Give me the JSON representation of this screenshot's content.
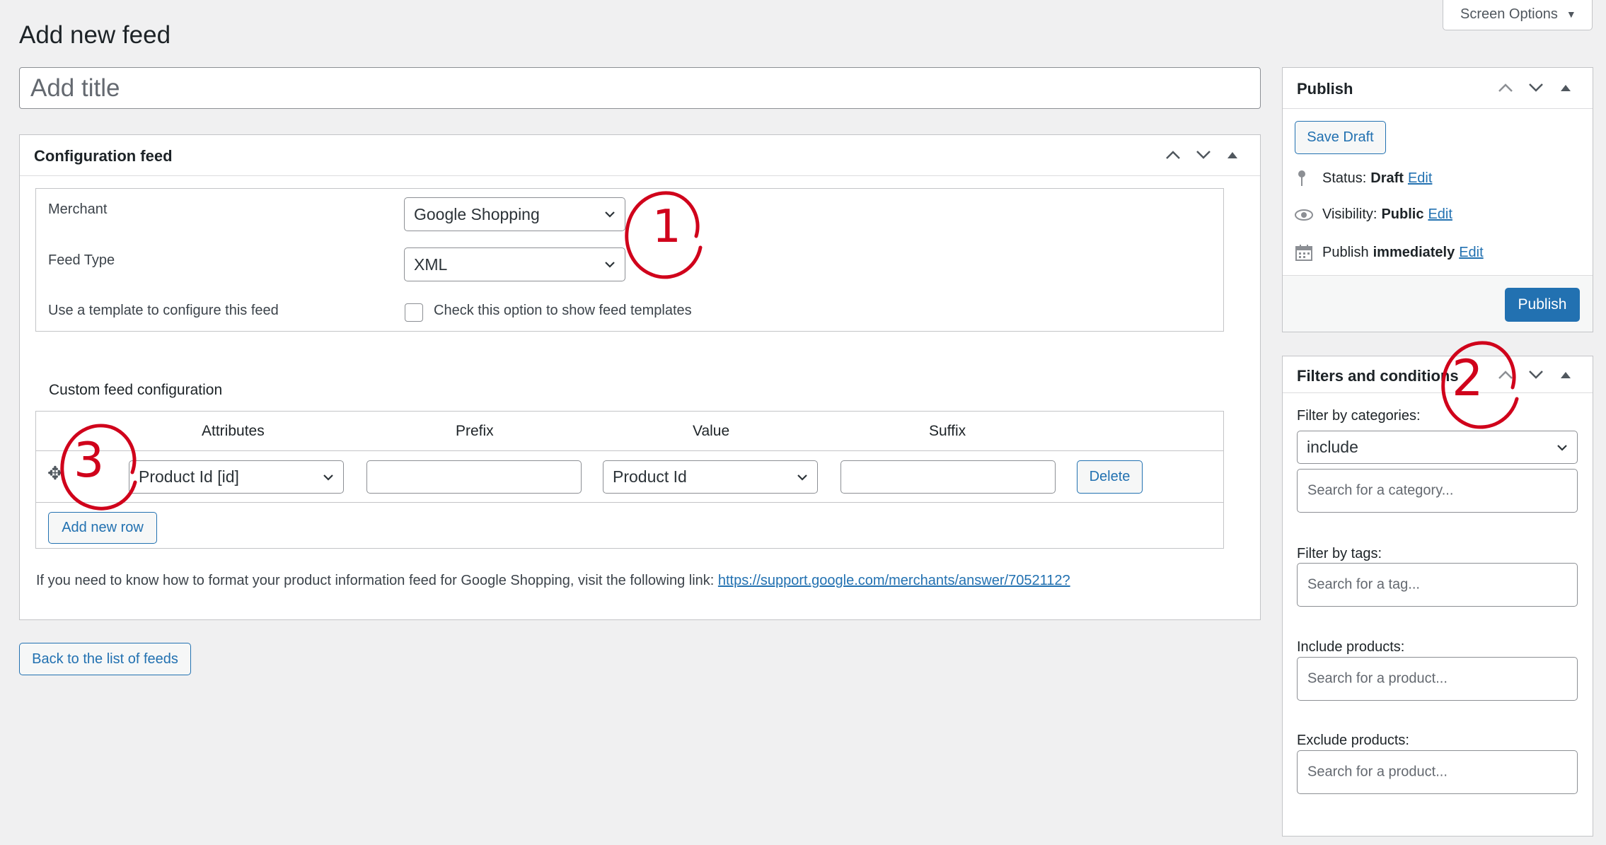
{
  "page": {
    "title": "Add new feed",
    "screen_options_label": "Screen Options",
    "title_placeholder": "Add title",
    "back_button": "Back to the list of feeds"
  },
  "config": {
    "header": "Configuration feed",
    "merchant_label": "Merchant",
    "merchant_value": "Google Shopping",
    "feed_type_label": "Feed Type",
    "feed_type_value": "XML",
    "template_label": "Use a template to configure this feed",
    "template_checkbox_label": "Check this option to show feed templates",
    "custom_header": "Custom feed configuration",
    "columns": [
      "Attributes",
      "Prefix",
      "Value",
      "Suffix"
    ],
    "row": {
      "attribute": "Product Id [id]",
      "value": "Product Id",
      "delete_label": "Delete"
    },
    "add_row_label": "Add new row",
    "help_text": "If you need to know how to format your product information feed for Google Shopping, visit the following link:",
    "help_link": "https://support.google.com/merchants/answer/7052112?"
  },
  "publish": {
    "header": "Publish",
    "save_draft": "Save Draft",
    "status_label": "Status:",
    "status_value": "Draft",
    "visibility_label": "Visibility:",
    "visibility_value": "Public",
    "publish_label": "Publish",
    "publish_value": "immediately",
    "edit_label": "Edit",
    "publish_button": "Publish"
  },
  "filters": {
    "header": "Filters and conditions",
    "categories_label": "Filter by categories:",
    "categories_mode": "include",
    "category_placeholder": "Search for a category...",
    "tags_label": "Filter by tags:",
    "tag_placeholder": "Search for a tag...",
    "include_label": "Include products:",
    "exclude_label": "Exclude products:",
    "product_placeholder": "Search for a product..."
  },
  "annotations": [
    "1",
    "2",
    "3"
  ],
  "colors": {
    "accent": "#2271b1",
    "annotation": "#d0021b",
    "background": "#f0f0f1"
  }
}
